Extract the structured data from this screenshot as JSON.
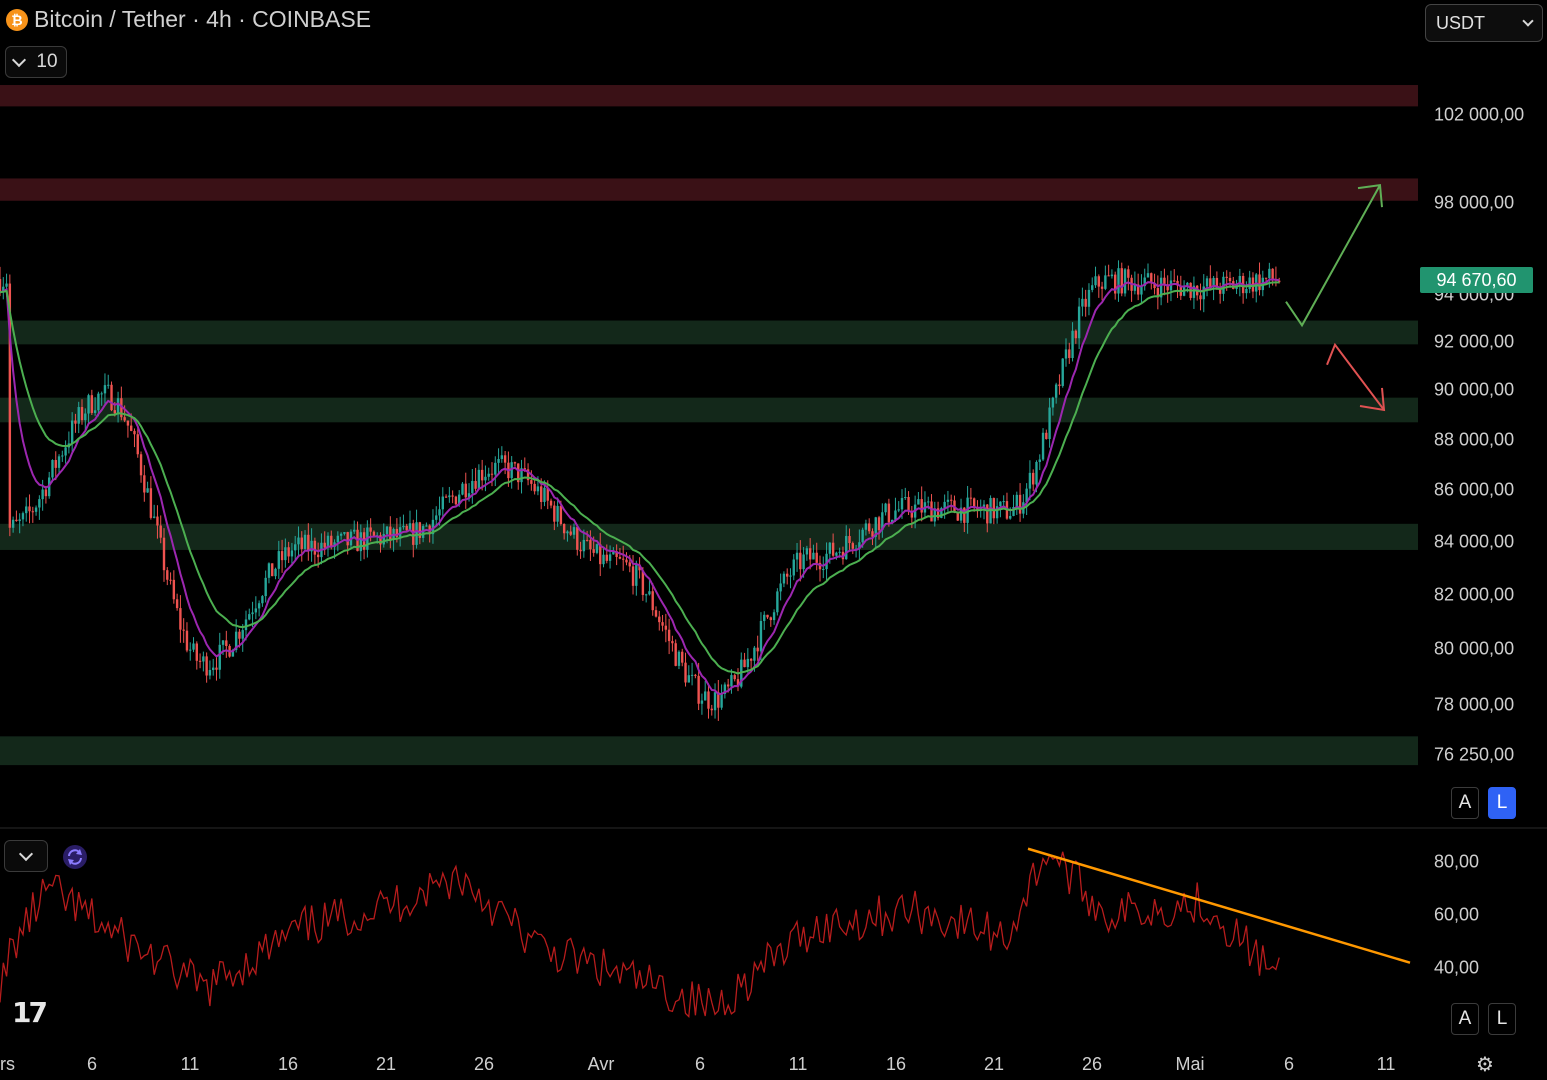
{
  "header": {
    "symbol_icon": "bitcoin-icon",
    "title": "Bitcoin / Tether · 4h · COINBASE",
    "indicator_count": "10",
    "currency": "USDT"
  },
  "last_price": "94 670,60",
  "scale_buttons": {
    "auto": "A",
    "log": "L"
  },
  "colors": {
    "background": "#000000",
    "candle_up": "#26a69a",
    "candle_down": "#ef5350",
    "ema_fast": "#9c27b0",
    "ema_slow": "#4caf50",
    "resistance_zone": "#3a1116",
    "support_zone": "#13281a",
    "rsi_line": "#b71c1c",
    "rsi_trendline": "#ff9800",
    "price_tag": "#21946f",
    "arrow_up": "#5fae55",
    "arrow_down": "#e05252"
  },
  "chart_data": [
    {
      "type": "line",
      "subtype": "candlestick",
      "symbol": "Bitcoin / Tether",
      "interval": "4h",
      "exchange": "COINBASE",
      "x_tick_labels": [
        "rs",
        "6",
        "11",
        "16",
        "21",
        "26",
        "Avr",
        "6",
        "11",
        "16",
        "21",
        "26",
        "Mai",
        "6",
        "11"
      ],
      "y_tick_labels": [
        "102 000,00",
        "98 000,00",
        "94 000,00",
        "92 000,00",
        "90 000,00",
        "88 000,00",
        "86 000,00",
        "84 000,00",
        "82 000,00",
        "80 000,00",
        "78 000,00",
        "76 250,00"
      ],
      "x": [
        "Mar 1",
        "Mar 6",
        "Mar 11",
        "Mar 16",
        "Mar 21",
        "Mar 26",
        "Apr 1",
        "Apr 6",
        "Apr 11",
        "Apr 16",
        "Apr 21",
        "Apr 26",
        "May 1",
        "May 5"
      ],
      "series": [
        {
          "values": [
            84500,
            89800,
            79500,
            83800,
            84200,
            86900,
            83200,
            78200,
            83400,
            85300,
            85200,
            94600,
            94300,
            94670
          ]
        }
      ],
      "zones": [
        {
          "kind": "resistance",
          "low": 102400,
          "high": 103400
        },
        {
          "kind": "resistance",
          "low": 98100,
          "high": 99100
        },
        {
          "kind": "support",
          "low": 91900,
          "high": 92900
        },
        {
          "kind": "support",
          "low": 88700,
          "high": 89700
        },
        {
          "kind": "support",
          "low": 83700,
          "high": 84700
        },
        {
          "kind": "support",
          "low": 75900,
          "high": 76900
        }
      ],
      "scenarios": [
        {
          "direction": "up",
          "from": 92700,
          "to": 98800
        },
        {
          "direction": "down",
          "from": 91800,
          "to": 89200
        }
      ],
      "last_price": 94670.6,
      "log_scale": true
    },
    {
      "type": "line",
      "indicator": "RSI",
      "y_tick_labels": [
        "80,00",
        "60,00",
        "40,00"
      ],
      "ylim": [
        20,
        90
      ],
      "x": [
        "Mar 1",
        "Mar 3",
        "Mar 6",
        "Mar 11",
        "Mar 16",
        "Mar 21",
        "Mar 24",
        "Mar 28",
        "Apr 1",
        "Apr 6",
        "Apr 11",
        "Apr 16",
        "Apr 21",
        "Apr 23",
        "Apr 26",
        "May 1",
        "May 5"
      ],
      "series": [
        {
          "values": [
            45,
            70,
            55,
            32,
            55,
            65,
            75,
            48,
            38,
            25,
            55,
            62,
            52,
            85,
            60,
            65,
            35
          ]
        }
      ],
      "trendline": {
        "from": 85,
        "to": 42
      }
    }
  ]
}
